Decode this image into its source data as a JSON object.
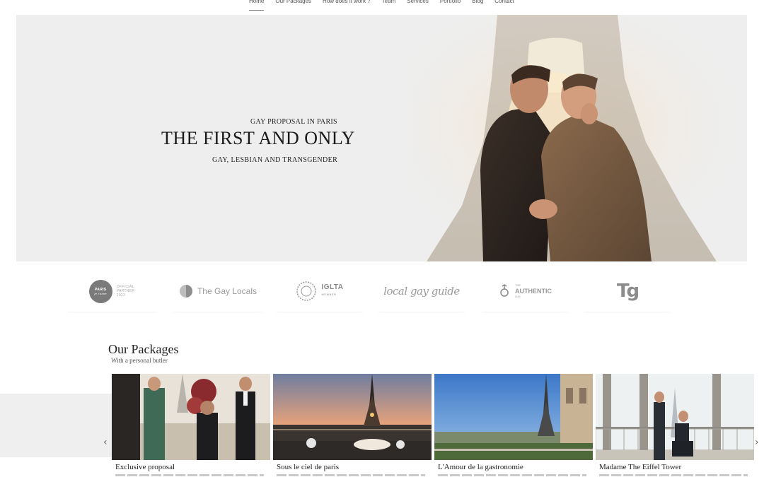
{
  "nav": {
    "items": [
      {
        "label": "Home",
        "active": true
      },
      {
        "label": "Our Packages"
      },
      {
        "label": "How does it work ?"
      },
      {
        "label": "Team"
      },
      {
        "label": "Services"
      },
      {
        "label": "Portfolio"
      },
      {
        "label": "Blog"
      },
      {
        "label": "Contact"
      }
    ]
  },
  "hero": {
    "kicker": "GAY PROPOSAL IN PARIS",
    "title": "THE FIRST AND ONLY",
    "subtitle": "GAY, LESBIAN AND TRANSGENDER"
  },
  "partners": {
    "paris": {
      "badge_top": "PARIS",
      "badge_bottom": "je t'aime",
      "side": [
        "OFFICIAL",
        "PARTNER",
        "2023"
      ]
    },
    "gay_locals": {
      "name": "The Gay Locals"
    },
    "iglta": {
      "name": "IGLTA",
      "sub": "MEMBER"
    },
    "local_gay_guide": {
      "name": "local gay guide"
    },
    "authentic_gay": {
      "top": "THE",
      "main": "AUTHENTIC",
      "bottom": "GAY"
    },
    "tg": {
      "name": "Tg"
    }
  },
  "packages": {
    "title": "Our Packages",
    "subtitle": "With a personal butler",
    "cards": [
      {
        "title": "Exclusive proposal"
      },
      {
        "title": "Sous le ciel de paris"
      },
      {
        "title": "L'Amour de la gastronomie"
      },
      {
        "title": "Madame The Eiffel Tower"
      }
    ],
    "prev_arrow": "‹",
    "next_arrow": "›"
  }
}
